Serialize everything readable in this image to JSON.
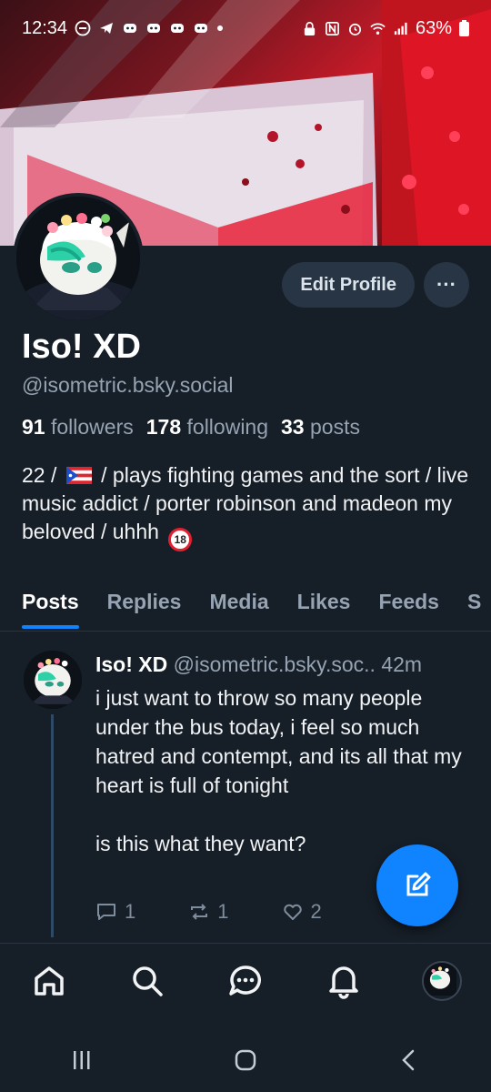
{
  "status_bar": {
    "time": "12:34",
    "battery": "63%"
  },
  "profile": {
    "display_name": "Iso! XD",
    "handle": "@isometric.bsky.social",
    "followers_count": "91",
    "followers_label": "followers",
    "following_count": "178",
    "following_label": "following",
    "posts_count": "33",
    "posts_label": "posts",
    "bio_part1": "22  / ",
    "bio_part2": " / plays fighting games and the sort / live music addict / porter robinson and madeon my beloved / uhhh ",
    "bio_badge": "18",
    "edit_label": "Edit Profile",
    "more_label": "···"
  },
  "tabs": [
    {
      "label": "Posts"
    },
    {
      "label": "Replies"
    },
    {
      "label": "Media"
    },
    {
      "label": "Likes"
    },
    {
      "label": "Feeds"
    },
    {
      "label": "S"
    }
  ],
  "post": {
    "author": "Iso! XD",
    "handle": "@isometric.bsky.soc..",
    "time": "42m",
    "body": "i just want to throw so many people under the bus today, i feel so much hatred and contempt, and its all that my heart is full of tonight\n\nis this what they want?",
    "replies": "1",
    "reposts": "1",
    "likes": "2"
  },
  "colors": {
    "accent": "#1083fe",
    "background": "#161e27",
    "muted": "#95a3b3"
  },
  "icons": {
    "nav": [
      "home-icon",
      "search-icon",
      "chat-icon",
      "bell-icon",
      "avatar"
    ],
    "fab": "compose-icon"
  }
}
